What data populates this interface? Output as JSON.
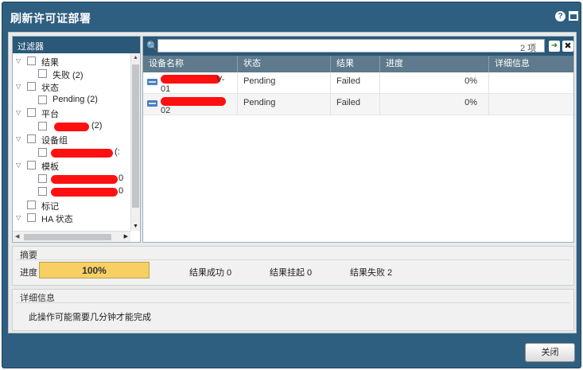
{
  "dialog": {
    "title": "刷新许可证部署",
    "help_icon": "help-icon",
    "maximize_icon": "maximize-icon"
  },
  "filter": {
    "header": "过滤器",
    "items": [
      {
        "label": "结果",
        "level": 0,
        "expanded": true
      },
      {
        "label": "失败 (2)",
        "level": 1
      },
      {
        "label": "状态",
        "level": 0,
        "expanded": true
      },
      {
        "label": "Pending (2)",
        "level": 1
      },
      {
        "label": "平台",
        "level": 0,
        "expanded": true
      },
      {
        "label": "(2)",
        "level": 1
      },
      {
        "label": "设备组",
        "level": 0,
        "expanded": true
      },
      {
        "label": "(:",
        "level": 1
      },
      {
        "label": "模板",
        "level": 0,
        "expanded": true
      },
      {
        "label": "0",
        "level": 1
      },
      {
        "label": "0",
        "level": 1
      },
      {
        "label": "标记",
        "level": 0
      },
      {
        "label": "HA 状态",
        "level": 0,
        "expanded": true
      }
    ]
  },
  "devices": {
    "search_value": "",
    "count_label": "2 项",
    "columns": [
      "设备名称",
      "状态",
      "结果",
      "进度",
      "详细信息"
    ],
    "rows": [
      {
        "name_line1": "V-",
        "name_line2": "01",
        "status": "Pending",
        "result": "Failed",
        "progress": "0%",
        "details": ""
      },
      {
        "name_line1": "",
        "name_line2": "02",
        "status": "Pending",
        "result": "Failed",
        "progress": "0%",
        "details": ""
      }
    ]
  },
  "summary": {
    "title": "摘要",
    "progress_label": "进度",
    "progress_value": 1.0,
    "progress_text": "100%",
    "success": "结果成功 0",
    "pending": "结果挂起 0",
    "failed": "结果失败 2",
    "progress_color": "#f7cf63"
  },
  "details": {
    "title": "详细信息",
    "message": "此操作可能需要几分钟才能完成"
  },
  "footer": {
    "close_label": "关闭"
  },
  "colors": {
    "window": "#2f5f80",
    "header": "#2a5878",
    "grid_header": "#5e7a8c",
    "redaction": "#ff1010"
  }
}
